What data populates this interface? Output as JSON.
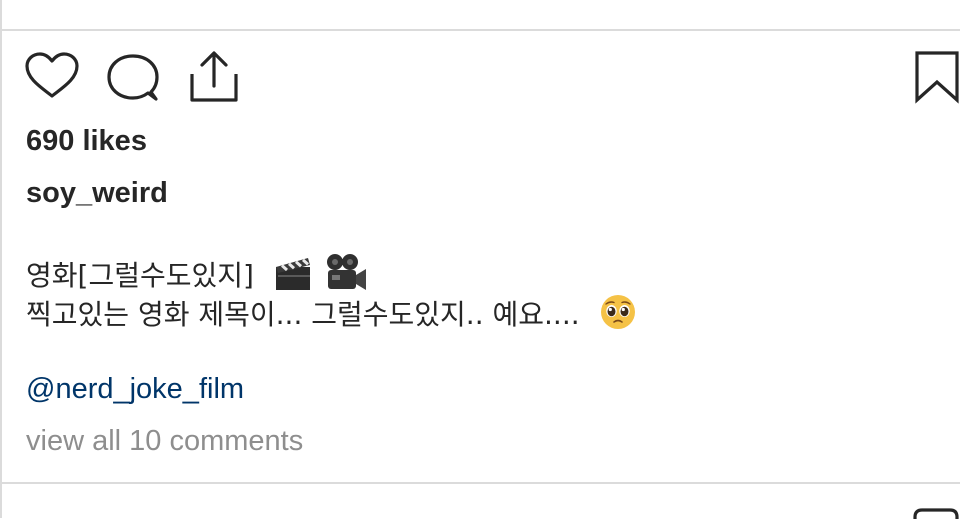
{
  "post": {
    "likes": "690 likes",
    "username": "soy_weird",
    "caption_line1": "영화[그럴수도있지]",
    "caption_line2": "찍고있는 영화 제목이... 그럴수도있지.. 예요....",
    "mention": "@nerd_joke_film",
    "view_comments": "view all 10 comments"
  },
  "icons": {
    "like": "heart-icon",
    "comment": "comment-bubble-icon",
    "share": "share-upload-icon",
    "save": "bookmark-icon",
    "caption_emojis_line1": [
      "clapper-board-emoji",
      "movie-camera-emoji"
    ],
    "caption_emojis_line2": [
      "pleading-face-emoji"
    ]
  },
  "colors": {
    "text": "#262626",
    "mention": "#003569",
    "muted": "#8e8e8e",
    "divider": "#dbdbdb"
  }
}
